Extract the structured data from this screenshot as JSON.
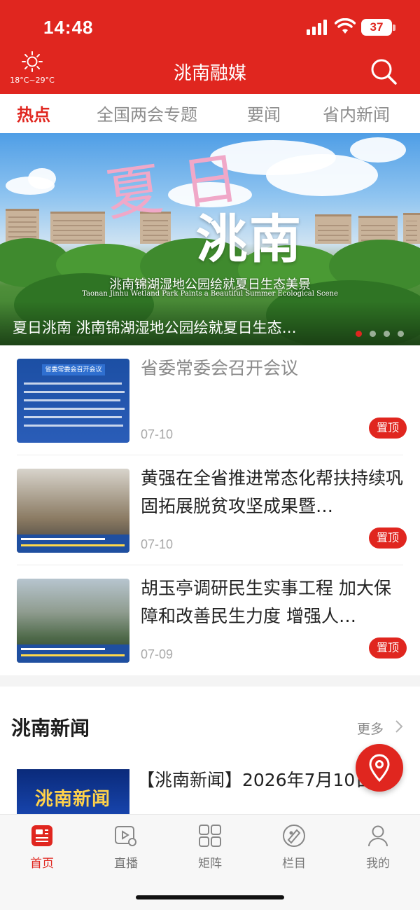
{
  "status": {
    "time": "14:48",
    "battery": "37"
  },
  "header": {
    "temp": "18°C~29°C",
    "title": "洮南融媒"
  },
  "tabs": [
    {
      "label": "热点"
    },
    {
      "label": "全国两会专题"
    },
    {
      "label": "要闻"
    },
    {
      "label": "省内新闻"
    }
  ],
  "banner": {
    "art_title_1": "夏日",
    "art_title_2": "洮南",
    "art_subtitle_cn": "洮南锦湖湿地公园绘就夏日生态美景",
    "art_subtitle_en": "Taonan Jinhu Wetland Park Paints a Beautiful Summer Ecological Scene",
    "caption": "夏日洮南  洮南锦湖湿地公园绘就夏日生态…",
    "active_dot": 0
  },
  "news": [
    {
      "title": "省委常委会召开会议",
      "date": "07-10",
      "badge": "置顶",
      "thumb_heading": "省委常委会召开会议"
    },
    {
      "title": "黄强在全省推进常态化帮扶持续巩固拓展脱贫攻坚成果暨…",
      "date": "07-10",
      "badge": "置顶"
    },
    {
      "title": "胡玉亭调研民生实事工程 加大保障和改善民生力度 增强人…",
      "date": "07-09",
      "badge": "置顶"
    }
  ],
  "section": {
    "title": "洮南新闻",
    "more": "更多",
    "item_title": "【洮南新闻】2026年7月10日",
    "item_thumb": "洮南新闻"
  },
  "tabbar": [
    {
      "label": "首页",
      "icon": "news-icon"
    },
    {
      "label": "直播",
      "icon": "live-icon"
    },
    {
      "label": "矩阵",
      "icon": "grid-icon"
    },
    {
      "label": "栏目",
      "icon": "column-icon"
    },
    {
      "label": "我的",
      "icon": "user-icon"
    }
  ],
  "colors": {
    "accent": "#e0261f"
  }
}
